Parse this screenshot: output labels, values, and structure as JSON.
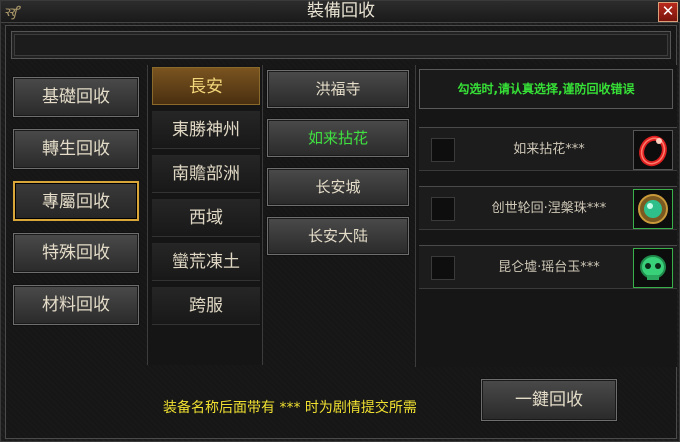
{
  "window": {
    "logo_text": "ꝛꝛꝭ",
    "title": "裝備回收",
    "close_glyph": "✕"
  },
  "categories": [
    {
      "label": "基礎回收",
      "active": false
    },
    {
      "label": "轉生回收",
      "active": false
    },
    {
      "label": "專屬回收",
      "active": true
    },
    {
      "label": "特殊回收",
      "active": false
    },
    {
      "label": "材料回收",
      "active": false
    }
  ],
  "regions": [
    {
      "label": "長安",
      "active": true
    },
    {
      "label": "東勝神州",
      "active": false
    },
    {
      "label": "南贍部洲",
      "active": false
    },
    {
      "label": "西域",
      "active": false
    },
    {
      "label": "蠻荒凍土",
      "active": false
    },
    {
      "label": "跨服",
      "active": false
    }
  ],
  "locations": [
    {
      "label": "洪福寺",
      "highlight": false
    },
    {
      "label": "如来拈花",
      "highlight": true
    },
    {
      "label": "长安城",
      "highlight": false
    },
    {
      "label": "长安大陆",
      "highlight": false
    }
  ],
  "notice": "勾选时,请认真选择,谨防回收错误",
  "items": [
    {
      "name": "如来拈花***",
      "icon": "red-ring-icon",
      "icon_color": "#e02020"
    },
    {
      "name": "创世轮回·涅槃珠***",
      "icon": "jade-orb-icon",
      "icon_color": "#2fbf8a"
    },
    {
      "name": "昆仑墟·瑶台玉***",
      "icon": "jade-skull-icon",
      "icon_color": "#39d07a"
    }
  ],
  "bottom_hint": "装备名称后面带有 *** 时为剧情提交所需",
  "recycle_button": "一鍵回收",
  "colors": {
    "active_border": "#d9a63a",
    "green_text": "#36e036",
    "hint_yellow": "#f0e030"
  }
}
